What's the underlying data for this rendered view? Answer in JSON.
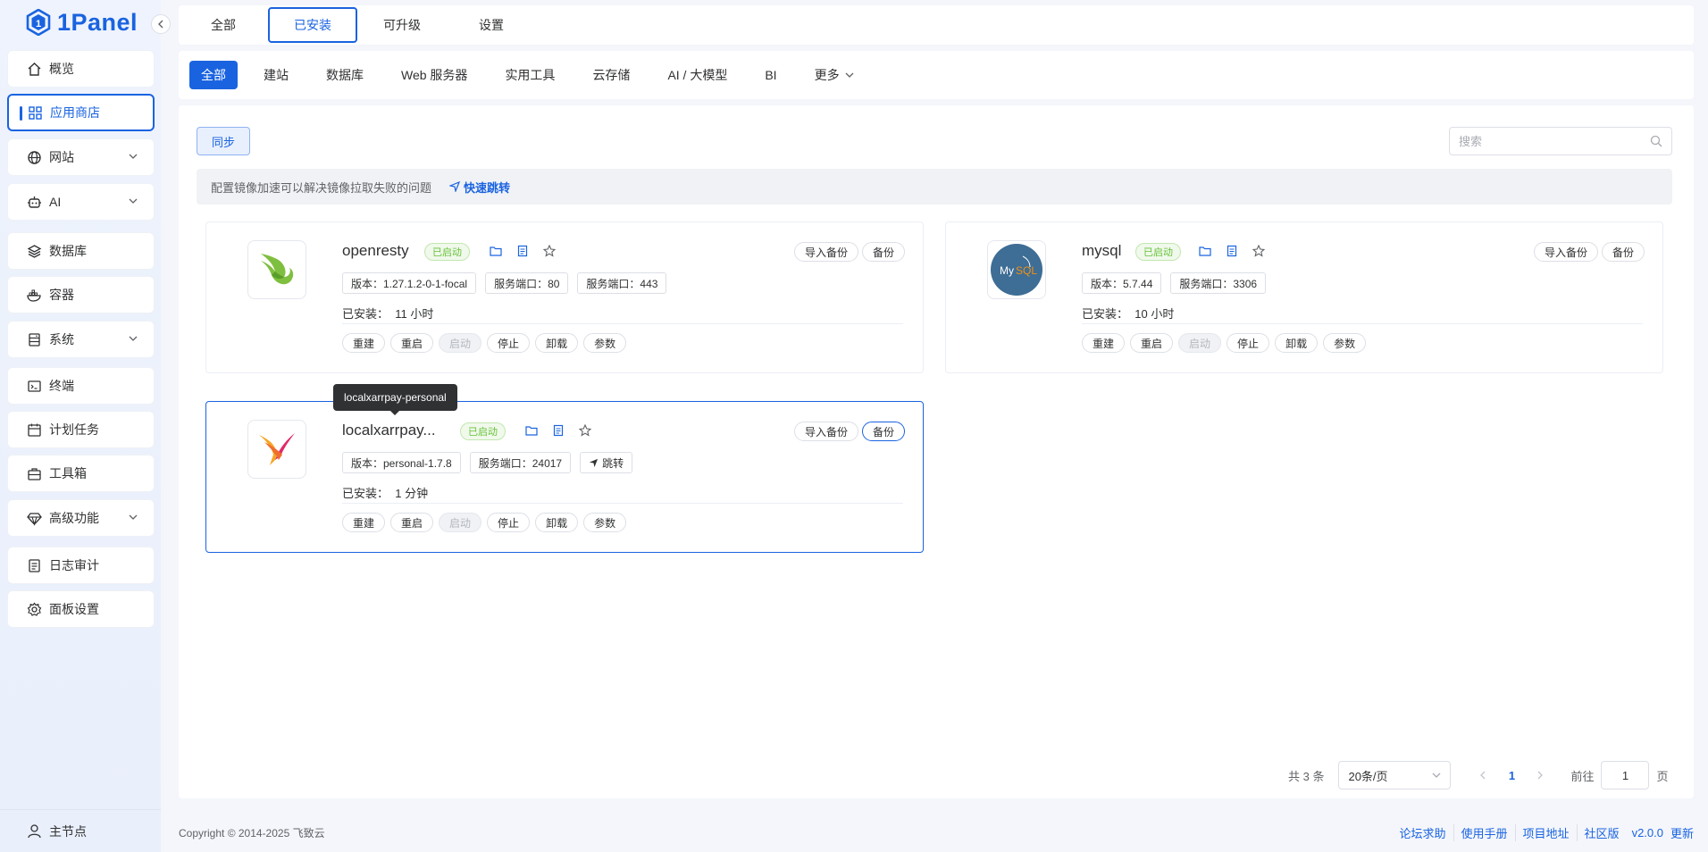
{
  "brand": {
    "name": "1Panel"
  },
  "sidebar": {
    "items": [
      {
        "label": "概览",
        "icon": "home-icon"
      },
      {
        "label": "应用商店",
        "icon": "grid-icon",
        "active": true
      },
      {
        "label": "网站",
        "icon": "globe-icon",
        "expandable": true
      },
      {
        "label": "AI",
        "icon": "robot-icon",
        "expandable": true
      },
      {
        "label": "数据库",
        "icon": "layers-icon"
      },
      {
        "label": "容器",
        "icon": "docker-icon"
      },
      {
        "label": "系统",
        "icon": "server-icon",
        "expandable": true
      },
      {
        "label": "终端",
        "icon": "terminal-icon"
      },
      {
        "label": "计划任务",
        "icon": "calendar-icon"
      },
      {
        "label": "工具箱",
        "icon": "toolbox-icon"
      },
      {
        "label": "高级功能",
        "icon": "diamond-icon",
        "expandable": true
      },
      {
        "label": "日志审计",
        "icon": "log-icon"
      },
      {
        "label": "面板设置",
        "icon": "gear-icon"
      }
    ],
    "node": {
      "label": "主节点",
      "icon": "user-icon"
    }
  },
  "top_tabs": [
    {
      "label": "全部"
    },
    {
      "label": "已安装",
      "active": true
    },
    {
      "label": "可升级"
    },
    {
      "label": "设置"
    }
  ],
  "categories": [
    {
      "label": "全部",
      "active": true
    },
    {
      "label": "建站"
    },
    {
      "label": "数据库"
    },
    {
      "label": "Web 服务器"
    },
    {
      "label": "实用工具"
    },
    {
      "label": "云存储"
    },
    {
      "label": "AI / 大模型"
    },
    {
      "label": "BI"
    },
    {
      "label": "更多"
    }
  ],
  "toolbar": {
    "sync_label": "同步",
    "search_placeholder": "搜索"
  },
  "notice": {
    "text": "配置镜像加速可以解决镜像拉取失败的问题",
    "link": "快速跳转"
  },
  "apps": [
    {
      "name": "openresty",
      "status": "已启动",
      "tags": [
        "版本：1.27.1.2-0-1-focal",
        "服务端口：80",
        "服务端口：443"
      ],
      "installed_label": "已安装：",
      "installed_time": "11 小时",
      "import_backup": "导入备份",
      "backup": "备份"
    },
    {
      "name": "mysql",
      "status": "已启动",
      "tags": [
        "版本：5.7.44",
        "服务端口：3306"
      ],
      "installed_label": "已安装：",
      "installed_time": "10 小时",
      "import_backup": "导入备份",
      "backup": "备份"
    },
    {
      "name": "localxarrpay...",
      "full_name": "localxarrpay-personal",
      "status": "已启动",
      "tags": [
        "版本：personal-1.7.8",
        "服务端口：24017"
      ],
      "jump": "跳转",
      "installed_label": "已安装：",
      "installed_time": "1 分钟",
      "import_backup": "导入备份",
      "backup": "备份"
    }
  ],
  "actions": [
    "重建",
    "重启",
    "启动",
    "停止",
    "卸载",
    "参数"
  ],
  "pagination": {
    "total": "共 3 条",
    "page_size": "20条/页",
    "current": "1",
    "goto_label": "前往",
    "goto_value": "1",
    "page_suffix": "页"
  },
  "footer": {
    "copyright": "Copyright © 2014-2025 飞致云",
    "links": [
      "论坛求助",
      "使用手册",
      "项目地址",
      "社区版"
    ],
    "version": "v2.0.0",
    "update": "更新"
  },
  "colors": {
    "accent": "#1a63e0",
    "success": "#67c23a"
  }
}
